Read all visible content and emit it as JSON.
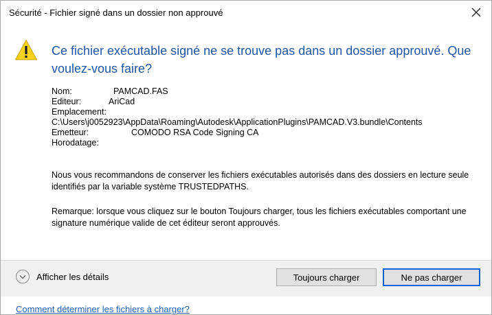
{
  "window": {
    "title": "Sécurité - Fichier signé dans un dossier non approuvé",
    "close_glyph": "✕"
  },
  "icons": {
    "warning": "warning-icon",
    "close": "close-icon",
    "chevron": "chevron-down-icon"
  },
  "colors": {
    "heading": "#1f55a5",
    "link": "#1e5eb8",
    "warning_fill": "#f8d21c",
    "default_button_border": "#0a64cf"
  },
  "message": {
    "heading": "Ce fichier exécutable signé ne se trouve pas dans un dossier approuvé. Que voulez-vous faire?"
  },
  "file_info": {
    "name_label": "Nom:",
    "name_value": "PAMCAD.FAS",
    "editor_label": "Editeur:",
    "editor_value": "AriCad",
    "location_label": "Emplacement:",
    "location_value": "C:\\Users\\j0052923\\AppData\\Roaming\\Autodesk\\ApplicationPlugins\\PAMCAD.V3.bundle\\Contents",
    "issuer_label": "Emetteur:",
    "issuer_value": "COMODO RSA Code Signing CA",
    "timestamp_label": "Horodatage:",
    "timestamp_value": ""
  },
  "paragraphs": {
    "recommendation": "Nous vous recommandons de conserver les fichiers exécutables autorisés dans des dossiers en lecture seule identifiés par la variable système TRUSTEDPATHS.",
    "remark": "Remarque: lorsque vous cliquez sur le bouton Toujours charger, tous les fichiers exécutables comportant une signature numérique valide de cet éditeur seront approuvés."
  },
  "footer": {
    "details_label": "Afficher les détails",
    "always_load_label": "Toujours charger",
    "dont_load_label": "Ne pas charger"
  },
  "help_link": "Comment déterminer les fichiers à charger?"
}
